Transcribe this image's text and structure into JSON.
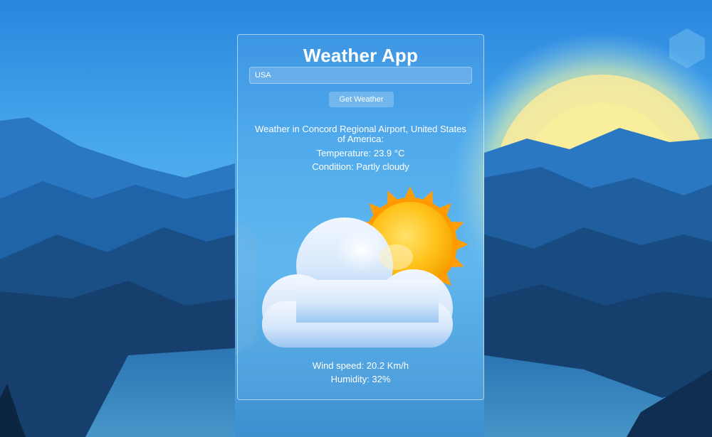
{
  "app": {
    "title": "Weather App"
  },
  "search": {
    "value": "USA",
    "button_label": "Get Weather"
  },
  "weather": {
    "location_text": "Weather in Concord Regional Airport, United States of America:",
    "temperature_text": "Temperature: 23.9 °C",
    "condition_text": "Condition: Partly cloudy",
    "wind_text": "Wind speed: 20.2 Km/h",
    "humidity_text": "Humidity: 32%",
    "icon": "partly-cloudy-icon"
  },
  "colors": {
    "sky_top": "#2f8ee0",
    "sky_mid": "#5fb8ef",
    "sun_core": "#ffc21a",
    "sun_rays": "#ff9a00",
    "cloud_light": "#e8f2ff",
    "cloud_shade": "#8fbff0"
  }
}
